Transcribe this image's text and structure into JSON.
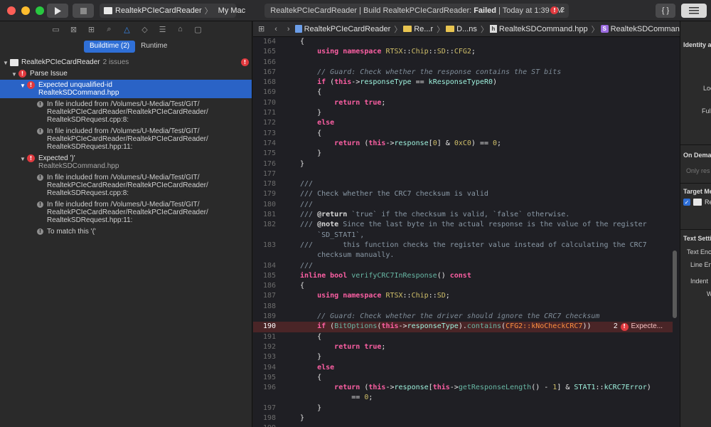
{
  "toolbar": {
    "scheme_target": "RealtekPCIeCardReader",
    "scheme_device": "My Mac",
    "status_prefix": "RealtekPCIeCardReader | Build RealtekPCIeCardReader:",
    "status_result": "Failed",
    "status_time": "| Today at 1:39 AM",
    "error_count": "2",
    "library_button": "{ }"
  },
  "navigator": {
    "tabs": [
      "Buildtime (2)",
      "Runtime"
    ],
    "project": {
      "name": "RealtekPCIeCardReader",
      "issue_count": "2 issues"
    },
    "group": "Parse Issue",
    "issues": [
      {
        "title": "Expected unqualified-id",
        "file": "RealtekSDCommand.hpp",
        "notes": [
          [
            "In file included from /Volumes/U-Media/Test/GIT/",
            "RealtekPCIeCardReader/RealtekPCIeCardReader/",
            "RealtekSDRequest.cpp:8:"
          ],
          [
            "In file included from /Volumes/U-Media/Test/GIT/",
            "RealtekPCIeCardReader/RealtekPCIeCardReader/",
            "RealtekSDRequest.hpp:11:"
          ]
        ]
      },
      {
        "title": "Expected ')'",
        "file": "RealtekSDCommand.hpp",
        "notes": [
          [
            "In file included from /Volumes/U-Media/Test/GIT/",
            "RealtekPCIeCardReader/RealtekPCIeCardReader/",
            "RealtekSDRequest.cpp:8:"
          ],
          [
            "In file included from /Volumes/U-Media/Test/GIT/",
            "RealtekPCIeCardReader/RealtekPCIeCardReader/",
            "RealtekSDRequest.hpp:11:"
          ]
        ],
        "extra_note": "To match this '('"
      }
    ]
  },
  "jumpbar": {
    "crumbs": [
      "RealtekPCIeCardReader",
      "Re...r",
      "D...ns",
      "RealtekSDCommand.hpp",
      "RealtekSDCommand"
    ]
  },
  "editor": {
    "error_line": "190",
    "error_count": "2",
    "error_text": "Expecte..."
  },
  "inspector": {
    "identity": "Identity a",
    "loc": "Loc",
    "full": "Full",
    "on_demand": "On Deman",
    "only_res": "Only res",
    "target_membership": "Target Me",
    "target_item": "Re",
    "text_settings": "Text Setti",
    "text_enc": "Text Enc",
    "line_end": "Line En",
    "indent": "Indent",
    "w": "W"
  },
  "colors": {
    "accent": "#2f6fd6",
    "error": "#e0393e",
    "keyword": "#fc5fa3",
    "error_line_bg": "#4a2527"
  }
}
